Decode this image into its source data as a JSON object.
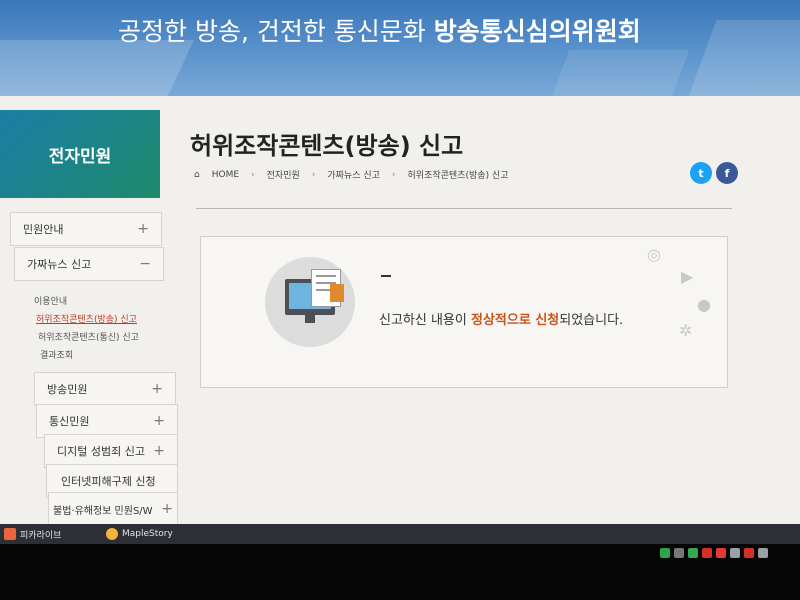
{
  "banner": {
    "text_normal": "공정한 방송, 건전한 통신문화",
    "text_bold": "방송통신심의위원회"
  },
  "sidebar": {
    "heading": "전자민원",
    "items": [
      {
        "label": "민원안내",
        "sign": "+"
      },
      {
        "label": "가짜뉴스 신고",
        "sign": "−"
      },
      {
        "label": "방송민원",
        "sign": "+"
      },
      {
        "label": "통신민원",
        "sign": "+"
      },
      {
        "label": "디지털 성범죄 신고",
        "sign": "+"
      },
      {
        "label": "인터넷피해구제 신청",
        "sign": ""
      },
      {
        "label": "불법·유해정보 민원S/W",
        "sign": "+"
      }
    ],
    "subitems": [
      "이용안내",
      "허위조작콘텐츠(방송) 신고",
      "허위조작콘텐츠(통신) 신고",
      "결과조회"
    ]
  },
  "content": {
    "title": "허위조작콘텐츠(방송) 신고",
    "breadcrumb": [
      "HOME",
      "전자민원",
      "가짜뉴스 신고",
      "허위조작콘텐츠(방송) 신고"
    ],
    "message_before": "신고하신 내용이",
    "message_highlight": "정상적으로 신청",
    "message_after": "되었습니다."
  },
  "taskbar": {
    "items": [
      "피카라이브",
      "MapleStory"
    ]
  },
  "colors": {
    "sidebar_head": "#1d8a6a",
    "highlight": "#c8541d",
    "twitter": "#1da1f2",
    "facebook": "#3b5998"
  },
  "icons": [
    "home-icon",
    "twitter-icon",
    "facebook-icon",
    "computer-document-icon",
    "globe-icon",
    "play-icon",
    "user-icon",
    "gear-icon"
  ]
}
